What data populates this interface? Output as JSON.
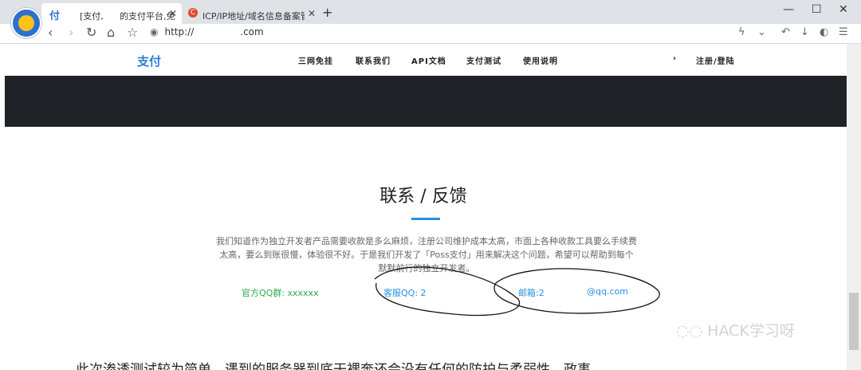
{
  "browser": {
    "tabs": [
      {
        "icon": "付",
        "label_a": "[支付,",
        "label_b": "的支付平台,免",
        "active": true
      },
      {
        "icon": "C",
        "label": "ICP/IP地址/域名信息备案管理系统",
        "active": false
      }
    ],
    "new_tab": "+",
    "window": {
      "minimize": "—",
      "maximize": "☐",
      "close": "✕"
    },
    "nav": {
      "back": "‹",
      "forward": "›",
      "refresh": "↻",
      "home": "⌂",
      "bookmark": "☆"
    },
    "url_prefix": "http://",
    "url_suffix": ".com",
    "tools": {
      "lightning": "ϟ",
      "dropdown": "⌄",
      "undo": "↶",
      "download": "↓",
      "extension": "◐",
      "menu": "☰"
    }
  },
  "site": {
    "brand": "支付",
    "menu": [
      "三网免挂",
      "联系我们",
      "API文档",
      "支付测试",
      "使用说明"
    ],
    "menu_arrow": "›",
    "login": "注册/登陆"
  },
  "contact": {
    "title": "联系 / 反馈",
    "desc": "我们知道作为独立开发者产品需要收款是多么麻烦，注册公司维护成本太高，市面上各种收款工具要么手续费太高，要么到账很慢，体验很不好。于是我们开发了「Poss支付」用来解决这个问题，希望可以帮助到每个默默前行的独立开发者。",
    "qq_group": "官方QQ群: xxxxxx",
    "service_qq": "客服QQ: 2",
    "email_prefix": "邮箱:2",
    "email_domain": "@qq.com"
  },
  "watermark": "HACK学习呀",
  "bottom_text": "此次渗透测试较为简单，遇到的服务器到底干裸奔还会没有任何的防护与柔弱性，政事"
}
